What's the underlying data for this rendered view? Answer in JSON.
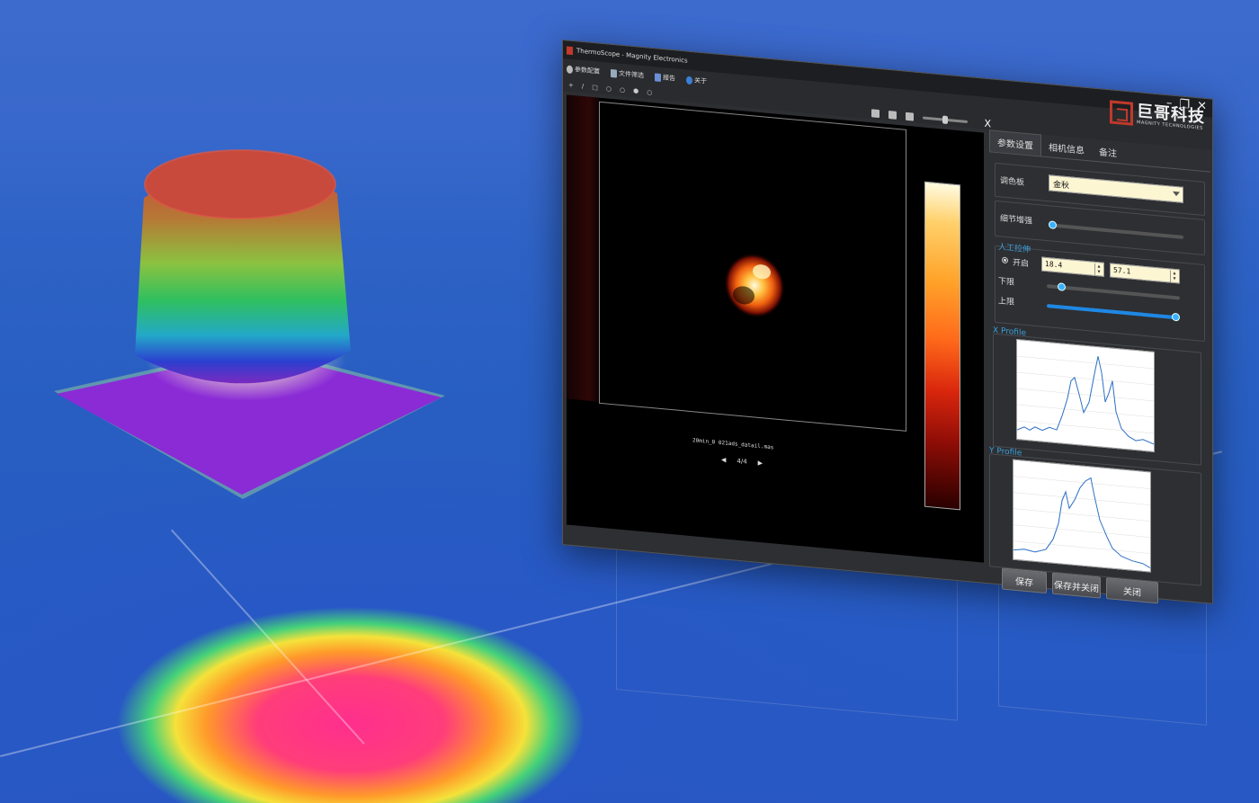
{
  "window": {
    "title": "ThermoScope - Magnity Electronics",
    "controls": {
      "minimize": "–",
      "maximize": "❐",
      "close": "✕"
    }
  },
  "menu": {
    "items": [
      {
        "label": "参数配置",
        "icon": "gear-icon"
      },
      {
        "label": "文件筛选",
        "icon": "filter-icon"
      },
      {
        "label": "报告",
        "icon": "report-icon"
      },
      {
        "label": "关于",
        "icon": "info-icon"
      }
    ]
  },
  "brand": {
    "name_cn": "巨哥科技",
    "name_en": "MAGNITY TECHNOLOGIES",
    "accent": "#c0392b"
  },
  "toolbar": {
    "tools": [
      "+",
      "/",
      "□",
      "○",
      "○",
      "⬢",
      "○"
    ],
    "close_label": "X"
  },
  "viewer": {
    "filename": "20min_0 021ads_datail.mas",
    "page": "4/4",
    "prev_icon": "◀",
    "next_icon": "▶"
  },
  "panel": {
    "tabs": [
      "参数设置",
      "相机信息",
      "备注"
    ],
    "active_tab": 0,
    "palette_label": "调色板",
    "palette_value": "金秋",
    "detail_label": "细节增强",
    "detail_level": 0.0,
    "manual_stretch_title": "人工拉伸",
    "enable_label": "开启",
    "lower_value": "18.4",
    "upper_value": "57.1",
    "lower_label": "下限",
    "upper_label": "上限",
    "lower_slider": 0.08,
    "upper_slider": 1.0,
    "xprofile_title": "X Profile",
    "yprofile_title": "Y Profile",
    "save_label": "保存",
    "save_close_label": "保存并关闭",
    "close_label": "关闭",
    "accent": "#1e88e5",
    "title_color": "#3aa0d8"
  }
}
